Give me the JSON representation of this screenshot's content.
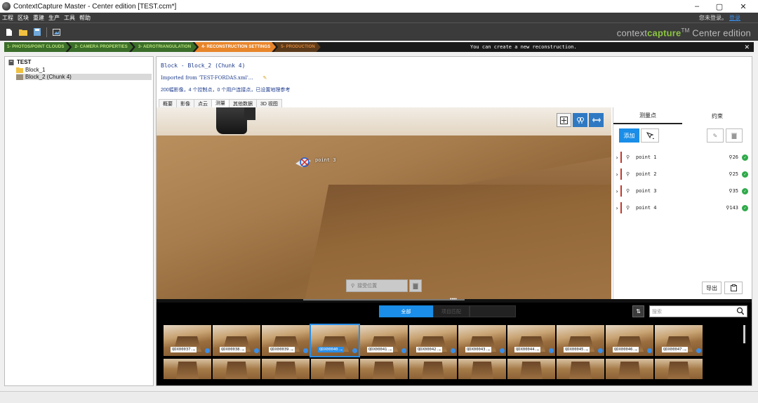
{
  "window": {
    "title": "ContextCapture Master - Center edition [TEST.ccm*]",
    "min": "–",
    "max": "▢",
    "close": "✕"
  },
  "menu": {
    "items": [
      "工程",
      "区块",
      "重建",
      "生产",
      "工具",
      "帮助"
    ],
    "login_text": "您未登录。",
    "login_link": "登录"
  },
  "toolbar": {
    "icons": [
      "new-file-icon",
      "open-folder-icon",
      "save-icon",
      "image-icon"
    ]
  },
  "brand": {
    "part1": "context",
    "part2": "capture",
    "tm": "TM",
    "edition": " Center edition"
  },
  "steps": {
    "items": [
      {
        "label": "1- PHOTOS/POINT CLOUDS",
        "state": "done"
      },
      {
        "label": "2- CAMERA PROPERTIES",
        "state": "done"
      },
      {
        "label": "3- AEROTRIANGULATION",
        "state": "done"
      },
      {
        "label": "4- RECONSTRUCTION SETTINGS",
        "state": "active"
      },
      {
        "label": "5- PRODUCTION",
        "state": "todo"
      }
    ],
    "message": "You can create a new reconstruction.",
    "close": "✕"
  },
  "tree": {
    "root": "TEST",
    "items": [
      "Block_1",
      "Block_2 (Chunk 4)"
    ]
  },
  "main": {
    "title": "Block - Block_2 (Chunk 4)",
    "imported": "Imported from 'TEST-FORDAS.xml'...",
    "summary": "200幅影像，4 个控制点，0 个用户连接点，已设置地理参考",
    "tabs": [
      "概要",
      "影像",
      "点云",
      "测量",
      "其他数据",
      "3D 视图"
    ],
    "active_tab": 3
  },
  "viewer": {
    "marker_label": "point 3",
    "accept_placeholder": "接受位置"
  },
  "photos": {
    "filters": [
      "全部",
      "项目匹配"
    ],
    "search_placeholder": "搜索",
    "thumbs": [
      "QDX00037.",
      "QDX00038.",
      "QDX00039.",
      "QDX00040.",
      "QDX00041.",
      "QDX00042.",
      "QDX00043.",
      "QDX00044.",
      "QDX00045.",
      "QDX00046.",
      "QDX00047."
    ],
    "selected_index": 3,
    "ellipsis": "…"
  },
  "right_panel": {
    "tabs": [
      "测量点",
      "约束"
    ],
    "add": "添加",
    "points": [
      {
        "name": "point 1",
        "count": "26"
      },
      {
        "name": "point 2",
        "count": "25"
      },
      {
        "name": "point 3",
        "count": "35"
      },
      {
        "name": "point 4",
        "count": "143"
      }
    ],
    "export": "导出"
  },
  "colors": {
    "accent": "#1a8ee8",
    "step_done": "#3a6e2a",
    "step_active": "#e8852a",
    "ok": "#2eaa4a",
    "pin_bar": "#c0392b"
  }
}
